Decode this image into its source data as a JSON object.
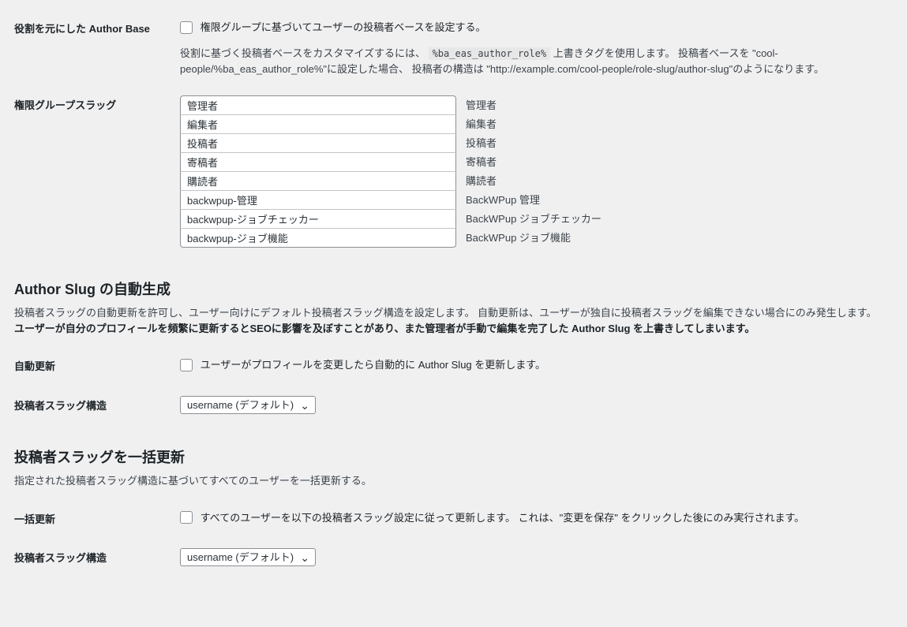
{
  "row1": {
    "label": "役割を元にした Author Base",
    "checkbox_label": "権限グループに基づいてユーザーの投稿者ベースを設定する。",
    "desc_prefix": "役割に基づく投稿者ベースをカスタマイズするには、 ",
    "desc_code": "%ba_eas_author_role%",
    "desc_suffix": " 上書きタグを使用します。 投稿者ベースを \"cool-people/%ba_eas_author_role%\"に設定した場合、 投稿者の構造は \"http://example.com/cool-people/role-slug/author-slug\"のようになります。"
  },
  "row2": {
    "label": "権限グループスラッグ",
    "slugs": [
      {
        "value": "管理者",
        "label": "管理者"
      },
      {
        "value": "編集者",
        "label": "編集者"
      },
      {
        "value": "投稿者",
        "label": "投稿者"
      },
      {
        "value": "寄稿者",
        "label": "寄稿者"
      },
      {
        "value": "購読者",
        "label": "購読者"
      },
      {
        "value": "backwpup-管理",
        "label": "BackWPup 管理"
      },
      {
        "value": "backwpup-ジョブチェッカー",
        "label": "BackWPup ジョブチェッカー"
      },
      {
        "value": "backwpup-ジョブ機能",
        "label": "BackWPup ジョブ機能"
      }
    ]
  },
  "section_autogen": {
    "heading": "Author Slug の自動生成",
    "desc_plain": "投稿者スラッグの自動更新を許可し、ユーザー向けにデフォルト投稿者スラッグ構造を設定します。 自動更新は、ユーザーが独自に投稿者スラッグを編集できない場合にのみ発生します。",
    "desc_bold": "ユーザーが自分のプロフィールを頻繁に更新するとSEOに影響を及ぼすことがあり、また管理者が手動で編集を完了した Author Slug を上書きしてしまいます。"
  },
  "row_auto": {
    "label": "自動更新",
    "checkbox_label": "ユーザーがプロフィールを変更したら自動的に Author Slug を更新します。"
  },
  "row_structure1": {
    "label": "投稿者スラッグ構造",
    "select_value": "username (デフォルト)"
  },
  "section_bulk": {
    "heading": "投稿者スラッグを一括更新",
    "desc": "指定された投稿者スラッグ構造に基づいてすべてのユーザーを一括更新する。"
  },
  "row_bulk": {
    "label": "一括更新",
    "checkbox_label": "すべてのユーザーを以下の投稿者スラッグ設定に従って更新します。 これは、\"変更を保存\" をクリックした後にのみ実行されます。"
  },
  "row_structure2": {
    "label": "投稿者スラッグ構造",
    "select_value": "username (デフォルト)"
  }
}
